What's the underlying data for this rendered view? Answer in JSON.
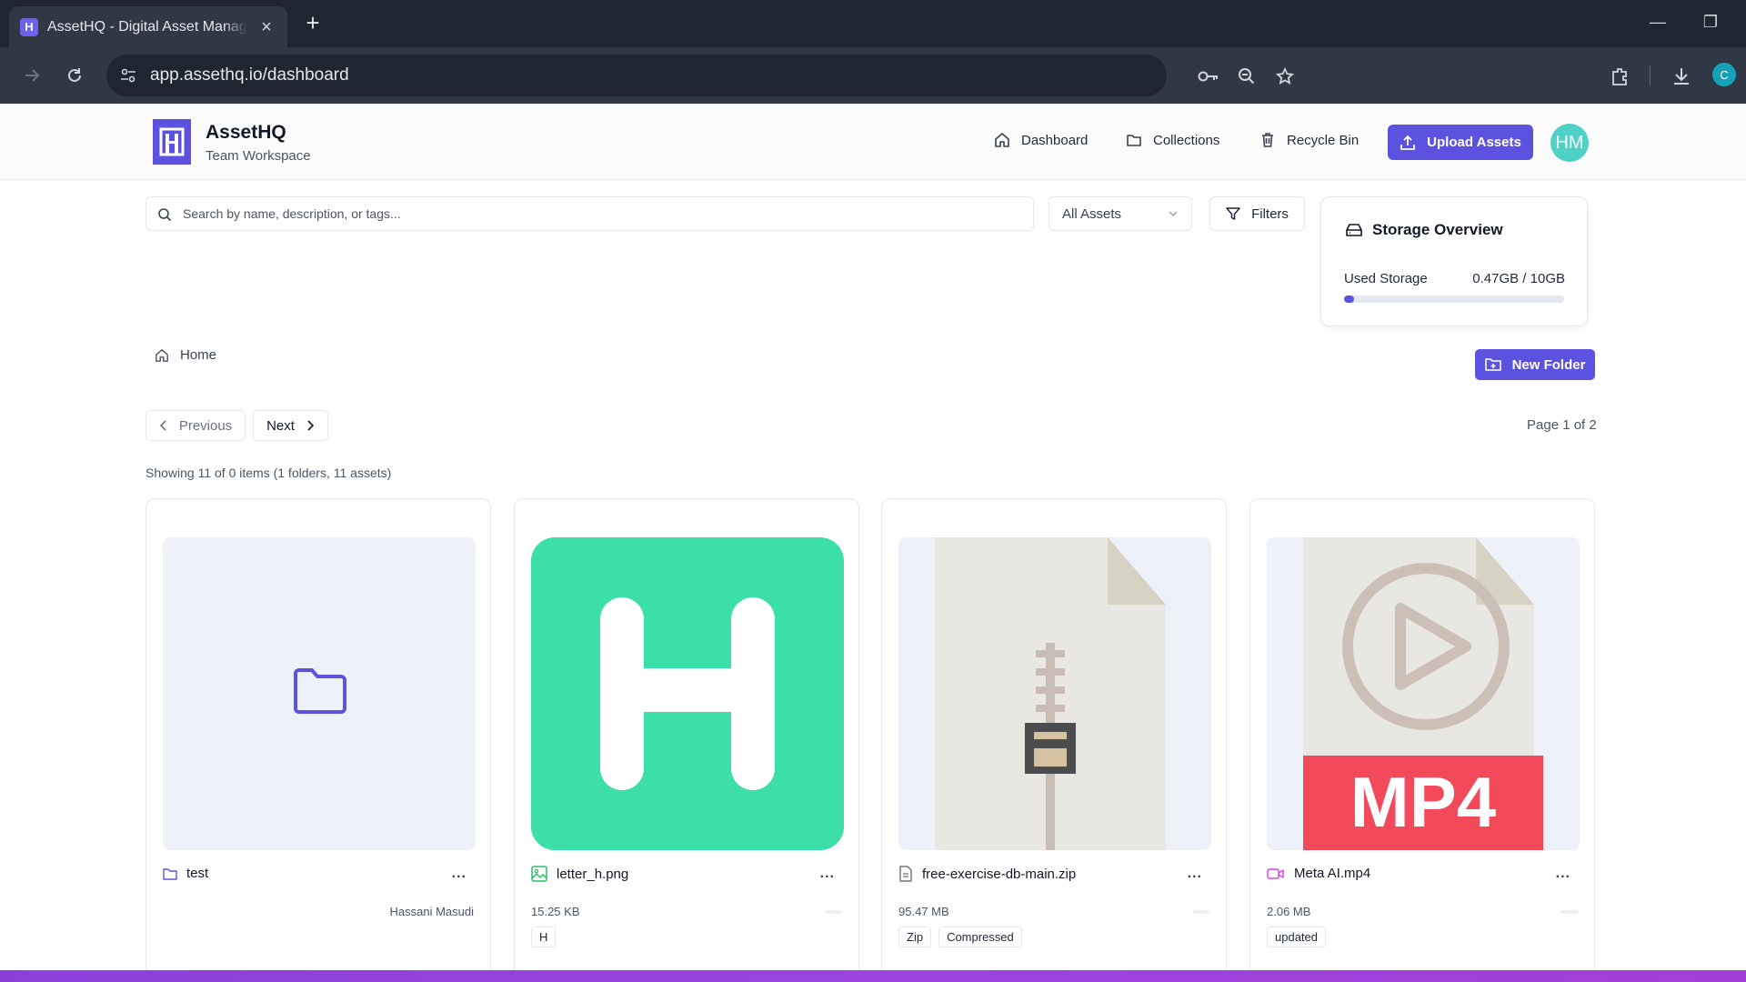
{
  "browser": {
    "tab_title": "AssetHQ - Digital Asset Management",
    "tab_favicon_letter": "H",
    "url": "app.assethq.io/dashboard",
    "profile_initial": "C"
  },
  "header": {
    "brand_name": "AssetHQ",
    "brand_subtitle": "Team Workspace",
    "nav": [
      {
        "label": "Dashboard",
        "icon": "home-icon"
      },
      {
        "label": "Collections",
        "icon": "folder-icon"
      },
      {
        "label": "Recycle Bin",
        "icon": "trash-icon"
      }
    ],
    "upload_label": "Upload Assets",
    "avatar_initials": "HM",
    "colors": {
      "accent": "#5b53e0",
      "avatar": "#4fd1c5"
    }
  },
  "search": {
    "placeholder": "Search by name, description, or tags...",
    "value": ""
  },
  "asset_filter": {
    "selected": "All Assets"
  },
  "filters_label": "Filters",
  "storage": {
    "title": "Storage Overview",
    "used_label": "Used Storage",
    "used_value": "0.47GB / 10GB",
    "used_fraction": 0.047
  },
  "breadcrumb": {
    "home_label": "Home"
  },
  "new_folder_label": "New Folder",
  "pagination": {
    "previous_label": "Previous",
    "next_label": "Next",
    "page_label": "Page 1 of 2"
  },
  "showing_text": "Showing 11 of 0 items (1 folders, 11 assets)",
  "cards": [
    {
      "name": "test",
      "type": "folder",
      "icon": "folder-icon",
      "owner": "Hassani Masudi",
      "size": "",
      "tags": []
    },
    {
      "name": "letter_h.png",
      "type": "image",
      "icon": "image-icon",
      "size": "15.25 KB",
      "thumb_letter": "H",
      "tags": [
        "H"
      ]
    },
    {
      "name": "free-exercise-db-main.zip",
      "type": "zip",
      "icon": "file-icon",
      "size": "95.47 MB",
      "tags": [
        "Zip",
        "Compressed"
      ]
    },
    {
      "name": "Meta AI.mp4",
      "type": "video",
      "icon": "video-icon",
      "size": "2.06 MB",
      "thumb_label": "MP4",
      "tags": [
        "updated"
      ]
    }
  ],
  "menu_label": "..."
}
